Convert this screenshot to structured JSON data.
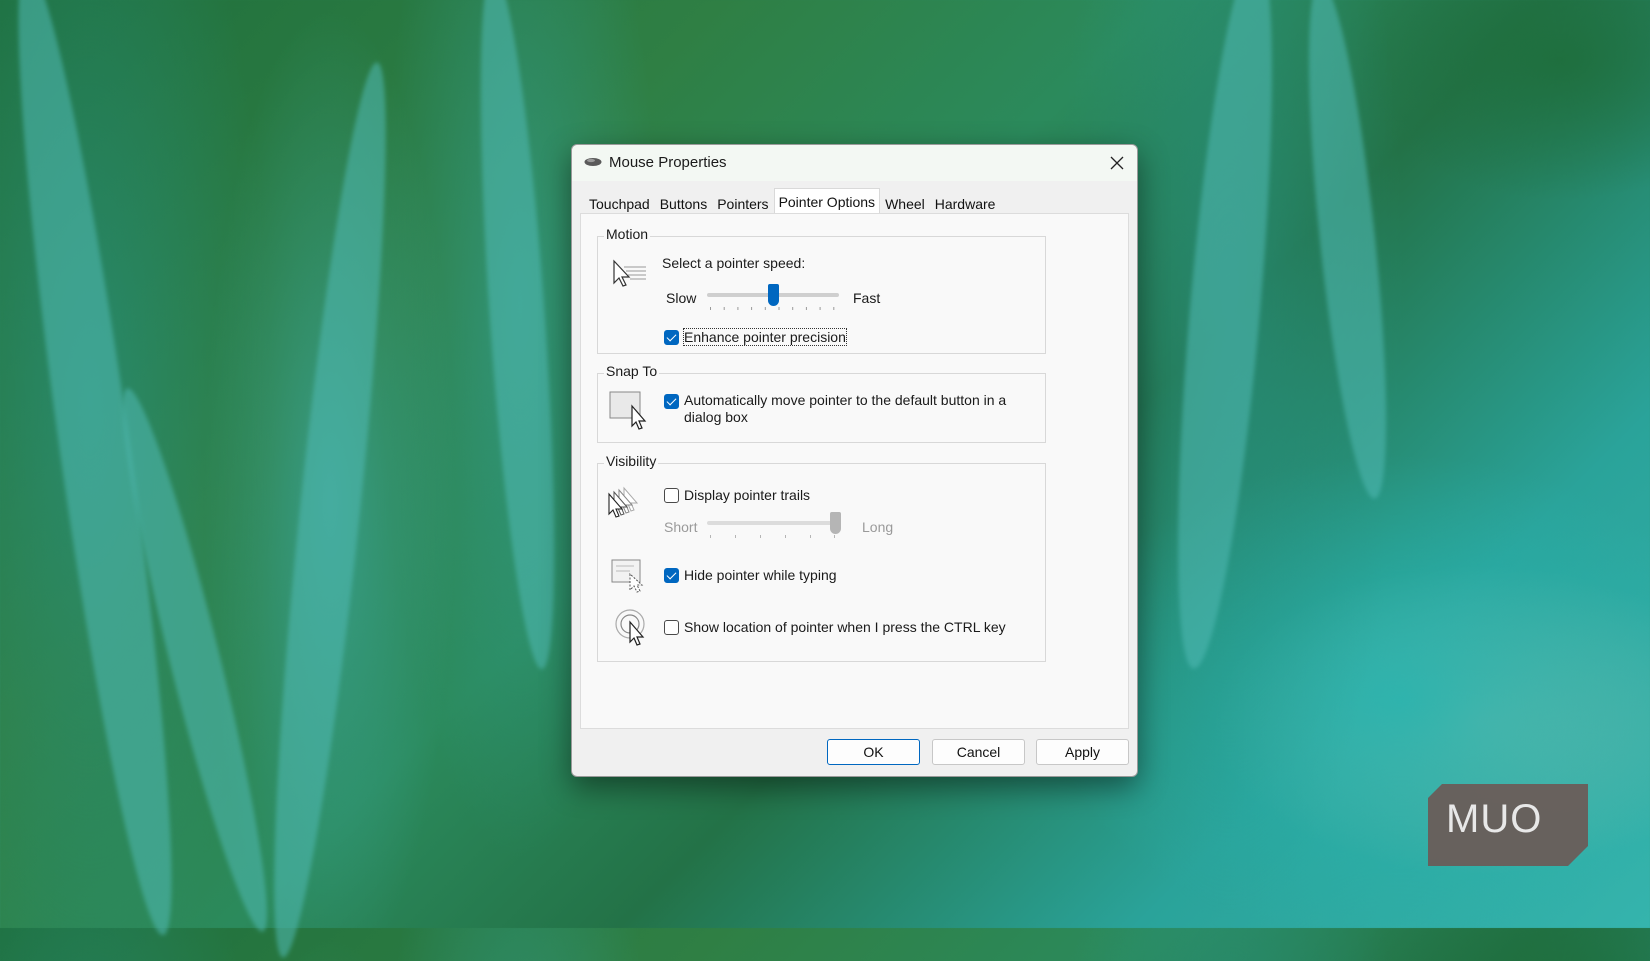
{
  "window": {
    "title": "Mouse Properties",
    "close_icon": "close-icon",
    "app_icon": "mouse-icon"
  },
  "tabs": [
    {
      "label": "Touchpad"
    },
    {
      "label": "Buttons"
    },
    {
      "label": "Pointers"
    },
    {
      "label": "Pointer Options",
      "active": true
    },
    {
      "label": "Wheel"
    },
    {
      "label": "Hardware"
    }
  ],
  "motion": {
    "group_title": "Motion",
    "speed_label": "Select a pointer speed:",
    "slow_label": "Slow",
    "fast_label": "Fast",
    "speed_level": 0.5,
    "enhance_label": "Enhance pointer precision",
    "enhance_checked": true
  },
  "snap_to": {
    "group_title": "Snap To",
    "auto_move_label_line1": "Automatically move pointer to the default button in a",
    "auto_move_label_line2": "dialog box",
    "auto_move_checked": true
  },
  "visibility": {
    "group_title": "Visibility",
    "trails_label": "Display pointer trails",
    "trails_checked": false,
    "short_label": "Short",
    "long_label": "Long",
    "trail_level": 1.0,
    "hide_label": "Hide pointer while typing",
    "hide_checked": true,
    "ctrl_label": "Show location of pointer when I press the CTRL key",
    "ctrl_checked": false
  },
  "buttons": {
    "ok": "OK",
    "cancel": "Cancel",
    "apply": "Apply"
  },
  "watermark": "MUO",
  "colors": {
    "accent": "#0067c0",
    "dialog_bg": "#f0f0f0"
  }
}
